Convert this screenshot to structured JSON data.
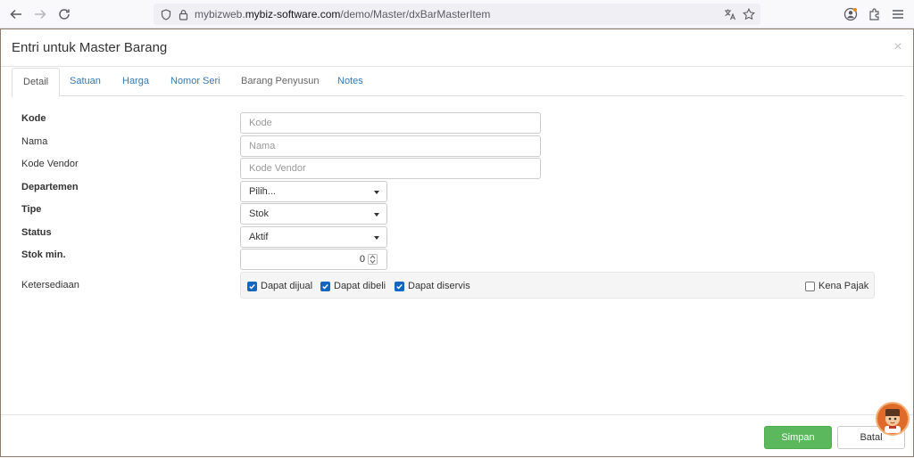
{
  "browser": {
    "url_prefix": "mybizweb.",
    "url_domain": "mybiz-software.com",
    "url_path": "/demo/Master/dxBarMasterItem"
  },
  "modal": {
    "title": "Entri untuk Master Barang",
    "close_label": "×"
  },
  "tabs": [
    {
      "label": "Detail",
      "active": true
    },
    {
      "label": "Satuan"
    },
    {
      "label": "Harga"
    },
    {
      "label": "Nomor Seri"
    },
    {
      "label": "Barang Penyusun"
    },
    {
      "label": "Notes"
    }
  ],
  "form": {
    "kode": {
      "label": "Kode",
      "placeholder": "Kode",
      "value": ""
    },
    "nama": {
      "label": "Nama",
      "placeholder": "Nama",
      "value": ""
    },
    "kode_vendor": {
      "label": "Kode Vendor",
      "placeholder": "Kode Vendor",
      "value": ""
    },
    "departemen": {
      "label": "Departemen",
      "value": "Pilih..."
    },
    "tipe": {
      "label": "Tipe",
      "value": "Stok"
    },
    "status": {
      "label": "Status",
      "value": "Aktif"
    },
    "stok_min": {
      "label": "Stok min.",
      "value": "0"
    },
    "ketersediaan": {
      "label": "Ketersediaan",
      "options": [
        {
          "label": "Dapat dijual",
          "checked": true
        },
        {
          "label": "Dapat dibeli",
          "checked": true
        },
        {
          "label": "Dapat diservis",
          "checked": true
        },
        {
          "label": "Kena Pajak",
          "checked": false
        }
      ]
    }
  },
  "footer": {
    "save_label": "Simpan",
    "cancel_label": "Batal"
  },
  "colors": {
    "link": "#337ab7",
    "save": "#5cb85c",
    "checkbox": "#1565c0"
  }
}
